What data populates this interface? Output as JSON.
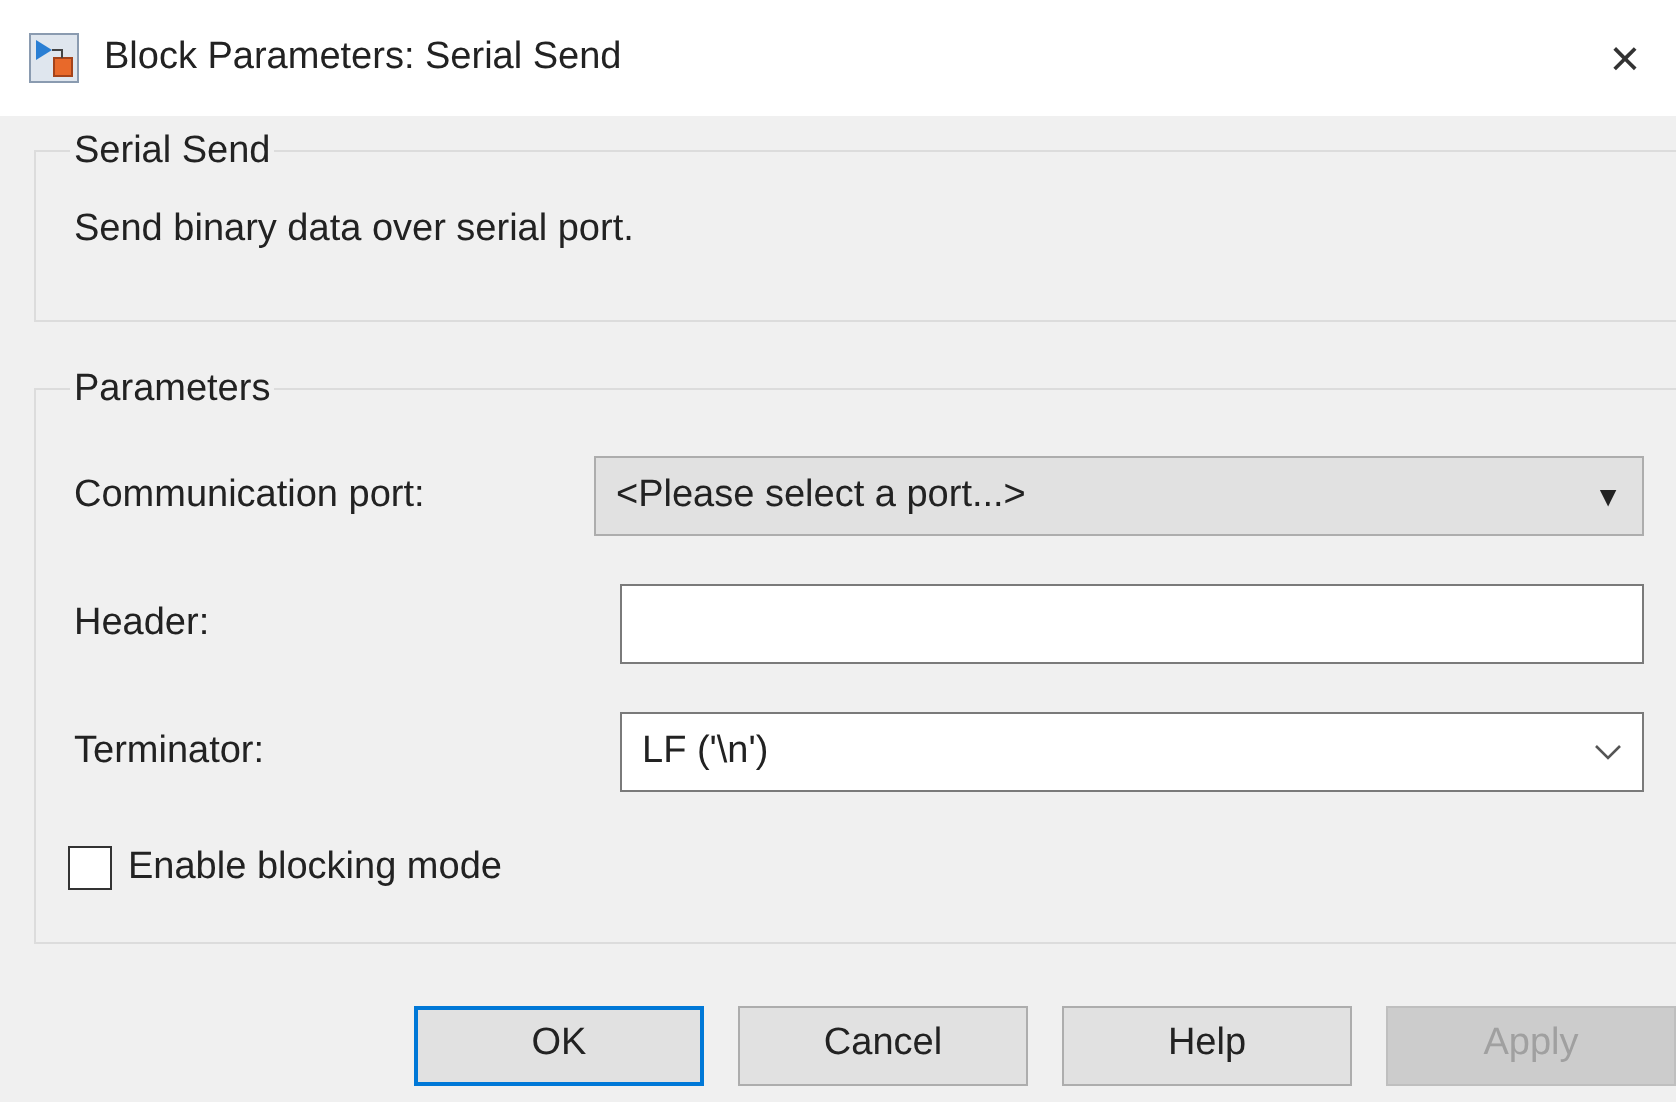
{
  "window": {
    "title": "Block Parameters: Serial Send",
    "close": "×"
  },
  "description_group": {
    "title": "Serial Send",
    "text": "Send binary data over serial port."
  },
  "parameters_group": {
    "title": "Parameters",
    "fields": [
      {
        "kind": "combo",
        "label": "Communication port:",
        "value": "<Please select a port...>",
        "arrow": "▼"
      },
      {
        "kind": "text",
        "label": "Header:"
      },
      {
        "kind": "dropdown",
        "label": "Terminator:",
        "value": "LF ('\\n')"
      }
    ],
    "checkbox": {
      "label": "Enable blocking mode",
      "checked": false
    }
  },
  "buttons": [
    {
      "label": "OK",
      "default": true,
      "disabled": false
    },
    {
      "label": "Cancel",
      "default": false,
      "disabled": false
    },
    {
      "label": "Help",
      "default": false,
      "disabled": false
    },
    {
      "label": "Apply",
      "default": false,
      "disabled": true
    }
  ]
}
